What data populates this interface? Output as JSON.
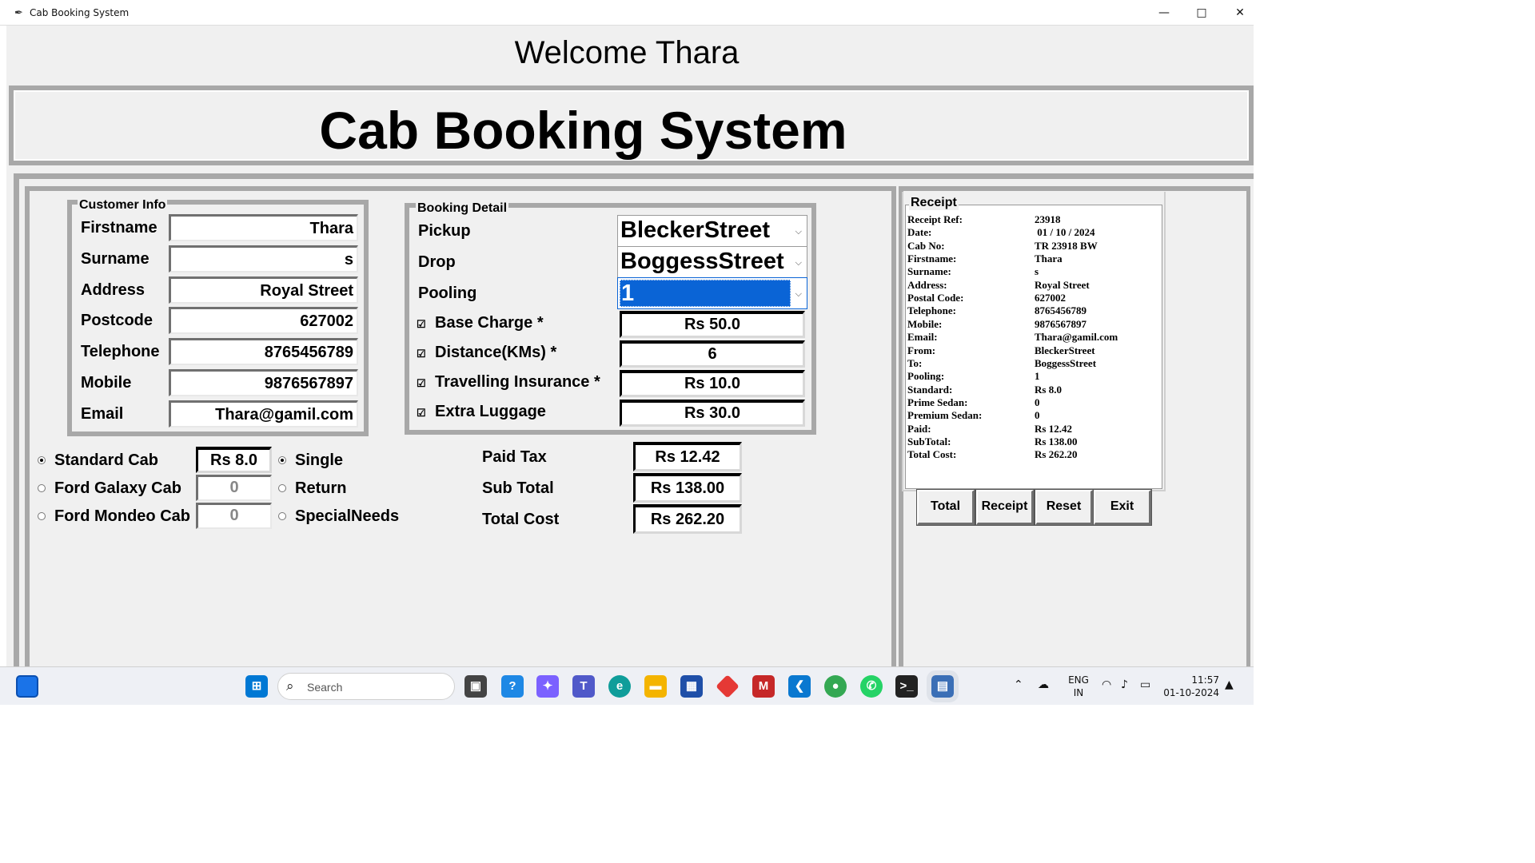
{
  "window": {
    "title": "Cab Booking System",
    "minimize": "—",
    "maximize": "□",
    "close": "✕"
  },
  "welcome": "Welcome Thara",
  "heading": "Cab Booking System",
  "customer_info": {
    "legend": "Customer Info",
    "fields": [
      {
        "label": "Firstname",
        "value": "Thara"
      },
      {
        "label": "Surname",
        "value": "s"
      },
      {
        "label": "Address",
        "value": "Royal Street"
      },
      {
        "label": "Postcode",
        "value": "627002"
      },
      {
        "label": "Telephone",
        "value": "8765456789"
      },
      {
        "label": "Mobile",
        "value": "9876567897"
      },
      {
        "label": "Email",
        "value": "Thara@gamil.com"
      }
    ]
  },
  "booking_detail": {
    "legend": "Booking Detail",
    "pickup": {
      "label": "Pickup",
      "value": "BleckerStreet"
    },
    "drop": {
      "label": "Drop",
      "value": "BoggessStreet"
    },
    "pooling": {
      "label": "Pooling",
      "value": "1"
    },
    "checks": [
      {
        "label": "Base Charge *",
        "value": "Rs 50.0",
        "checked": true
      },
      {
        "label": "Distance(KMs) *",
        "value": "6",
        "checked": true
      },
      {
        "label": "Travelling Insurance *",
        "value": "Rs 10.0",
        "checked": true
      },
      {
        "label": "Extra Luggage",
        "value": "Rs 30.0",
        "checked": true
      }
    ]
  },
  "cabs": [
    {
      "label": "Standard Cab",
      "value": "Rs 8.0",
      "selected": true
    },
    {
      "label": "Ford Galaxy Cab",
      "value": "0",
      "selected": false
    },
    {
      "label": "Ford Mondeo Cab",
      "value": "0",
      "selected": false
    }
  ],
  "trip": [
    {
      "label": "Single",
      "selected": true
    },
    {
      "label": "Return",
      "selected": false
    },
    {
      "label": "SpecialNeeds",
      "selected": false
    }
  ],
  "totals": [
    {
      "label": "Paid Tax",
      "value": "Rs 12.42"
    },
    {
      "label": "Sub Total",
      "value": "Rs 138.00"
    },
    {
      "label": "Total Cost",
      "value": "Rs 262.20"
    }
  ],
  "receipt": {
    "legend": "Receipt",
    "rows": [
      {
        "k": "Receipt Ref:",
        "v": "23918"
      },
      {
        "k": "Date:",
        "v": " 01 / 10 / 2024"
      },
      {
        "k": "Cab No:",
        "v": "TR 23918 BW"
      },
      {
        "k": "Firstname:",
        "v": "Thara"
      },
      {
        "k": "Surname:",
        "v": "s"
      },
      {
        "k": "Address:",
        "v": "Royal Street"
      },
      {
        "k": "Postal Code:",
        "v": "627002"
      },
      {
        "k": "Telephone:",
        "v": "8765456789"
      },
      {
        "k": "Mobile:",
        "v": "9876567897"
      },
      {
        "k": "Email:",
        "v": "Thara@gamil.com"
      },
      {
        "k": "From:",
        "v": "BleckerStreet"
      },
      {
        "k": "To:",
        "v": "BoggessStreet"
      },
      {
        "k": "Pooling:",
        "v": "1"
      },
      {
        "k": "Standard:",
        "v": "Rs 8.0"
      },
      {
        "k": "Prime Sedan:",
        "v": "0"
      },
      {
        "k": "Premium Sedan:",
        "v": "0"
      },
      {
        "k": "Paid:",
        "v": "Rs 12.42"
      },
      {
        "k": "SubTotal:",
        "v": "Rs 138.00"
      },
      {
        "k": "Total Cost:",
        "v": "Rs 262.20"
      }
    ]
  },
  "buttons": {
    "total": "Total",
    "receipt": "Receipt",
    "reset": "Reset",
    "exit": "Exit"
  },
  "taskbar": {
    "search": "Search",
    "lang": "ENG",
    "region": "IN",
    "time": "11:57",
    "date": "01-10-2024"
  }
}
